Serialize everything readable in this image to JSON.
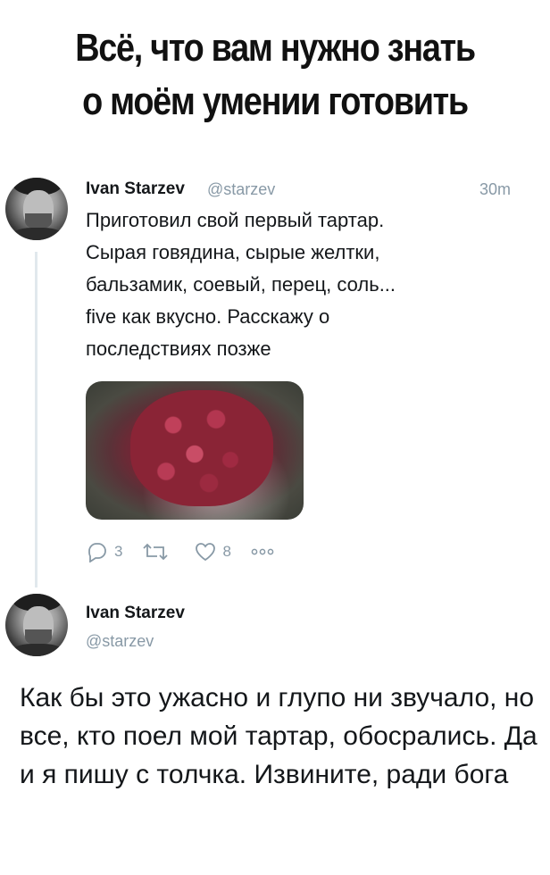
{
  "headline": {
    "line1": "Всё, что вам нужно знать",
    "line2": "о моём умении готовить"
  },
  "tweet": {
    "author_name": "Ivan Starzev",
    "author_handle": "@starzev",
    "time": "30m",
    "text": "Приготовил свой первый тартар. Сырая говядина, сырые желтки, бальзамик, соевый, перец, соль... five как вкусно. Расскажу о последствиях позже",
    "image_desc_icon": "photo-tartare",
    "actions": {
      "reply_count": "3",
      "retweet_count": "",
      "like_count": "8"
    }
  },
  "reply": {
    "author_name": "Ivan Starzev",
    "author_handle": "@starzev",
    "text": "Как бы это ужасно и глупо ни звучало, но все, кто поел мой тартар, обосрались. Да и я пишу с толчка. Извините, ради бога"
  },
  "colors": {
    "text": "#14171a",
    "muted": "#8899a6",
    "thread_line": "#e1e8ed"
  }
}
